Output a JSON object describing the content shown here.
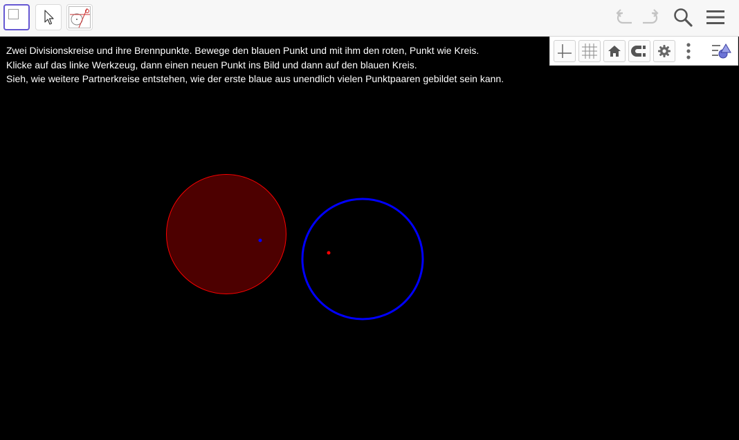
{
  "colors": {
    "toolbar_bg": "#f7f7f7",
    "canvas_bg": "#000000",
    "active_tool_border": "#6557d2",
    "red_circle_fill": "#4d0000",
    "red_circle_stroke": "#ff0000",
    "blue_circle_stroke": "#0000ff",
    "blue_point": "#0000ff",
    "red_point": "#ff0000",
    "text": "#ffffff"
  },
  "toolbar": {
    "tools": [
      {
        "icon": "custom-tool-icon",
        "active": true
      },
      {
        "icon": "move-arrow-icon",
        "active": false
      },
      {
        "icon": "circle-construction-icon",
        "active": false
      }
    ],
    "right_icons": [
      "undo-icon",
      "redo-icon",
      "search-icon",
      "menu-icon"
    ]
  },
  "style_bar": {
    "icons": [
      "axes-icon",
      "grid-icon",
      "home-icon",
      "point-capture-icon",
      "settings-gear-icon",
      "more-vert-icon",
      "toggle-style-bar-icon"
    ]
  },
  "instructions": {
    "line1": "Zwei Divisionskreise und ihre Brennpunkte. Bewege den blauen Punkt und mit ihm den roten, Punkt wie Kreis.",
    "line2": "Klicke auf das linke Werkzeug, dann einen neuen Punkt ins Bild und dann auf den blauen Kreis.",
    "line3": "Sieh, wie weitere Partnerkreise entstehen, wie der erste blaue aus unendlich vielen Punktpaaren gebildet sein kann."
  }
}
